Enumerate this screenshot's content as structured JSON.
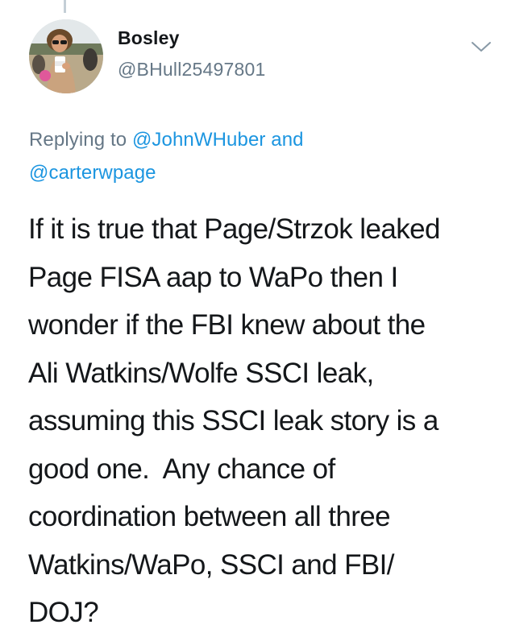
{
  "tweet": {
    "author": {
      "display_name": "Bosley",
      "handle": "@BHull25497801",
      "avatar_icon": "profile-photo"
    },
    "menu_icon": "chevron-down-icon",
    "reply_to": {
      "prefix": "Replying to",
      "mention1": "@JohnWHuber",
      "conjunction": "and",
      "mention2": "@carterwpage"
    },
    "body_lines": [
      "If it is true that Page/Strzok leaked",
      "Page FISA aap to WaPo then I",
      "wonder if the FBI knew about the",
      "Ali Watkins/Wolfe SSCI leak,",
      "assuming this SSCI leak story is a",
      "good one.  Any chance of",
      "coordination between all three",
      "Watkins/WaPo, SSCI and FBI/",
      "DOJ?"
    ]
  },
  "colors": {
    "text_primary": "#14171a",
    "text_secondary": "#657786",
    "link": "#1b95e0",
    "thread_line": "#c4cfd6"
  }
}
